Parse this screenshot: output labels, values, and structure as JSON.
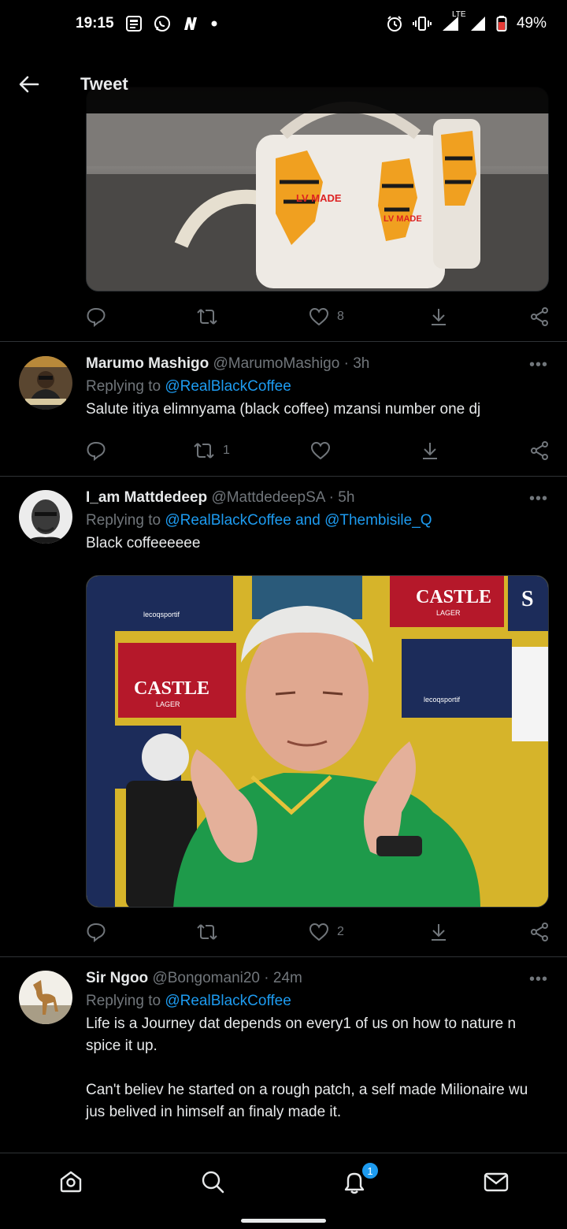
{
  "status_bar": {
    "time": "19:15",
    "network": "LTE",
    "battery": "49%"
  },
  "header": {
    "title": "Tweet"
  },
  "main_tweet_actions": {
    "like_count": "8"
  },
  "replies": [
    {
      "name": "Marumo Mashigo",
      "handle": "@MarumoMashigo",
      "time": "3h",
      "replying_prefix": "Replying to ",
      "replying_to": "@RealBlackCoffee",
      "text": "Salute itiya elimnyama (black coffee) mzansi number one dj",
      "retweet_count": "1"
    },
    {
      "name": "I_am Mattdedeep",
      "handle": "@MattdedeepSA",
      "time": "5h",
      "replying_prefix": "Replying to ",
      "replying_to": "@RealBlackCoffee and @Thembisile_Q",
      "text": "Black coffeeeeee",
      "like_count": "2"
    },
    {
      "name": "Sir Ngoo",
      "handle": "@Bongomani20",
      "time": "24m",
      "replying_prefix": "Replying to ",
      "replying_to": "@RealBlackCoffee",
      "text": "Life is a Journey dat depends on every1 of us on how to nature n spice it up.\n\nCan't believ he started on a rough patch, a self made Milionaire wu jus belived in himself an finaly made it."
    }
  ],
  "more_label": "•••",
  "meta_sep": " · ",
  "media_labels": {
    "bag_text": "LV MADE",
    "castle": "CASTLE",
    "castle_sub": "LAGER",
    "sponsor": "lecoqsportif",
    "edge": "S"
  },
  "bottom_nav": {
    "notifications_badge": "1"
  },
  "colors": {
    "background": "#000000",
    "accent": "#1d9bf0",
    "muted": "#71767b",
    "divider": "#2f3336"
  }
}
